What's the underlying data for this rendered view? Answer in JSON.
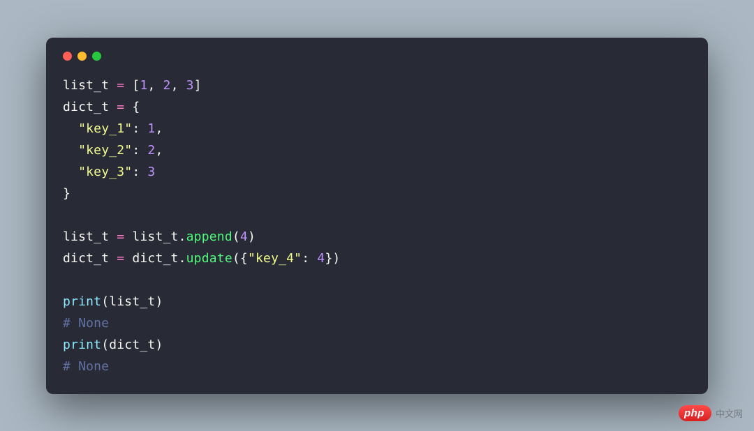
{
  "code": {
    "line1": {
      "var": "list_t",
      "eq": " = ",
      "open": "[",
      "n1": "1",
      "c1": ", ",
      "n2": "2",
      "c2": ", ",
      "n3": "3",
      "close": "]"
    },
    "line2": {
      "var": "dict_t",
      "eq": " = ",
      "open": "{"
    },
    "line3": {
      "indent": "  ",
      "key": "\"key_1\"",
      "colon": ": ",
      "val": "1",
      "comma": ","
    },
    "line4": {
      "indent": "  ",
      "key": "\"key_2\"",
      "colon": ": ",
      "val": "2",
      "comma": ","
    },
    "line5": {
      "indent": "  ",
      "key": "\"key_3\"",
      "colon": ": ",
      "val": "3"
    },
    "line6": {
      "close": "}"
    },
    "line8": {
      "var1": "list_t",
      "eq": " = ",
      "var2": "list_t",
      "dot": ".",
      "method": "append",
      "open": "(",
      "arg": "4",
      "close": ")"
    },
    "line9": {
      "var1": "dict_t",
      "eq": " = ",
      "var2": "dict_t",
      "dot": ".",
      "method": "update",
      "open": "({",
      "key": "\"key_4\"",
      "colon": ": ",
      "val": "4",
      "close": "})"
    },
    "line11": {
      "fn": "print",
      "open": "(",
      "arg": "list_t",
      "close": ")"
    },
    "line12": {
      "comment": "# None"
    },
    "line13": {
      "fn": "print",
      "open": "(",
      "arg": "dict_t",
      "close": ")"
    },
    "line14": {
      "comment": "# None"
    }
  },
  "footer": {
    "badge": "php",
    "text": "中文网"
  }
}
